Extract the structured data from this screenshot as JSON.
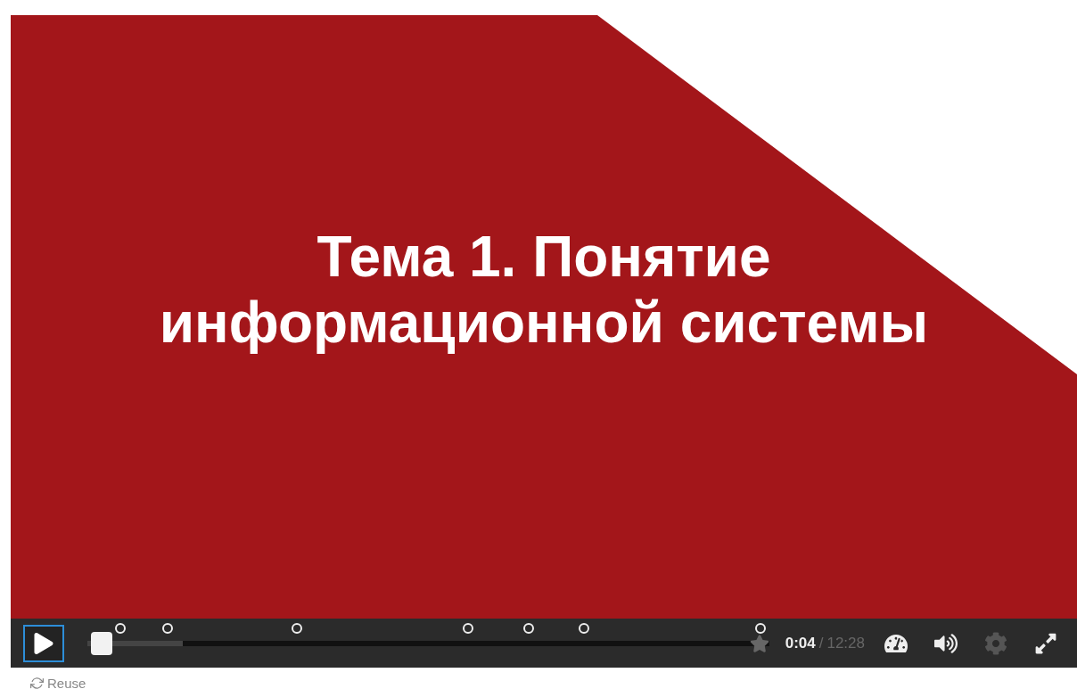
{
  "slide": {
    "title": "Тема 1. Понятие информационной системы"
  },
  "player": {
    "playing": false,
    "progress": {
      "level": 0.01
    },
    "current_time": "0:04",
    "separator": "/",
    "duration": "12:28"
  },
  "footer": {
    "reuse": "Reuse"
  }
}
